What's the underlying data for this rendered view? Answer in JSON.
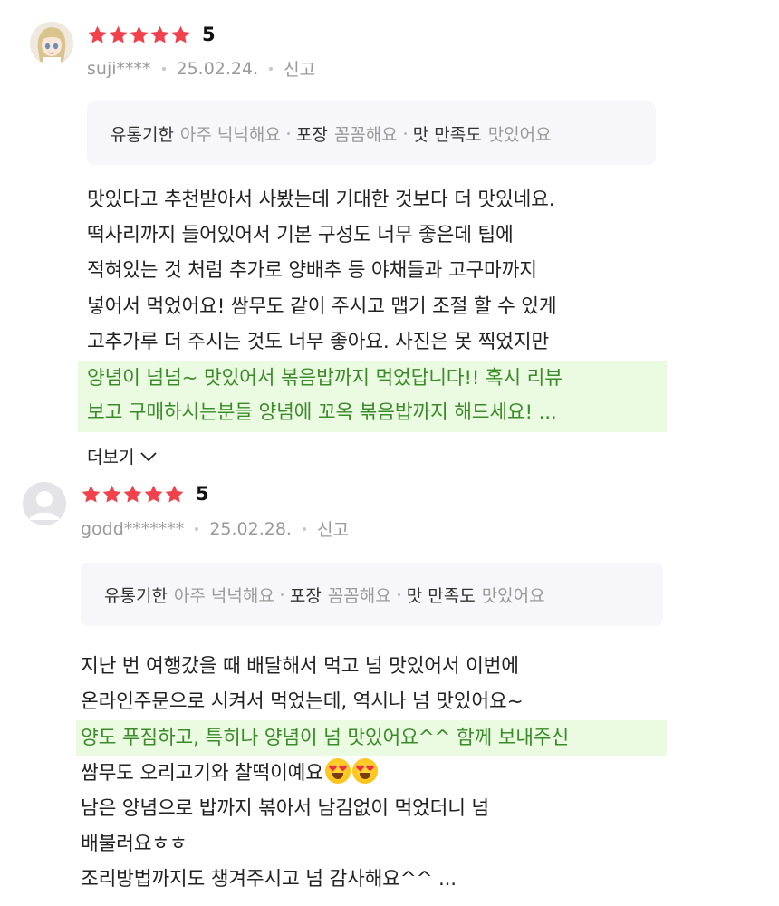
{
  "reviews": [
    {
      "score": "5",
      "user": "suji****",
      "date": "25.02.24.",
      "report": "신고",
      "tags": [
        {
          "key": "유통기한",
          "value": "아주 넉넉해요"
        },
        {
          "key": "포장",
          "value": "꼼꼼해요"
        },
        {
          "key": "맛 만족도",
          "value": "맛있어요"
        }
      ],
      "lines": [
        "맛있다고 추천받아서 사봤는데 기대한 것보다 더 맛있네요.",
        "떡사리까지 들어있어서 기본 구성도 너무 좋은데 팁에",
        "적혀있는 것 처럼 추가로 양배추 등 야채들과 고구마까지",
        "넣어서 먹었어요! 쌈무도 같이 주시고 맵기 조절 할 수 있게",
        "고추가루 더 주시는 것도 너무 좋아요. 사진은 못 찍었지만",
        "양념이 넘넘~ 맛있어서 볶음밥까지 먹었답니다!! 혹시 리뷰",
        "보고 구매하시는분들 양념에 꼬옥 볶음밥까지 해드세요! ..."
      ],
      "more_label": "더보기"
    },
    {
      "score": "5",
      "user": "godd*******",
      "date": "25.02.28.",
      "report": "신고",
      "tags": [
        {
          "key": "유통기한",
          "value": "아주 넉넉해요"
        },
        {
          "key": "포장",
          "value": "꼼꼼해요"
        },
        {
          "key": "맛 만족도",
          "value": "맛있어요"
        }
      ],
      "lines": [
        "지난 번 여행갔을 때 배달해서 먹고 넘 맛있어서 이번에",
        "온라인주문으로 시켜서 먹었는데, 역시나 넘 맛있어요~",
        "양도 푸짐하고, 특히나 양념이 넘 맛있어요^^ 함께 보내주신",
        "쌈무도 오리고기와 찰떡이예요",
        "남은 양념으로 밥까지 볶아서 남김없이 먹었더니 넘",
        "배불러요ㅎㅎ",
        "조리방법까지도 챙겨주시고 넘 감사해요^^ ..."
      ]
    }
  ],
  "icons": {
    "star": "star-icon",
    "chevron": "chevron-down-icon",
    "emoji": "heart-eyes-emoji-icon"
  },
  "colors": {
    "star": "#f0414d",
    "highlight_bg": "#eafbe1",
    "highlight_text": "#3c8b2a",
    "tag_bg": "#f7f7f9",
    "meta": "#9a9a9a"
  }
}
